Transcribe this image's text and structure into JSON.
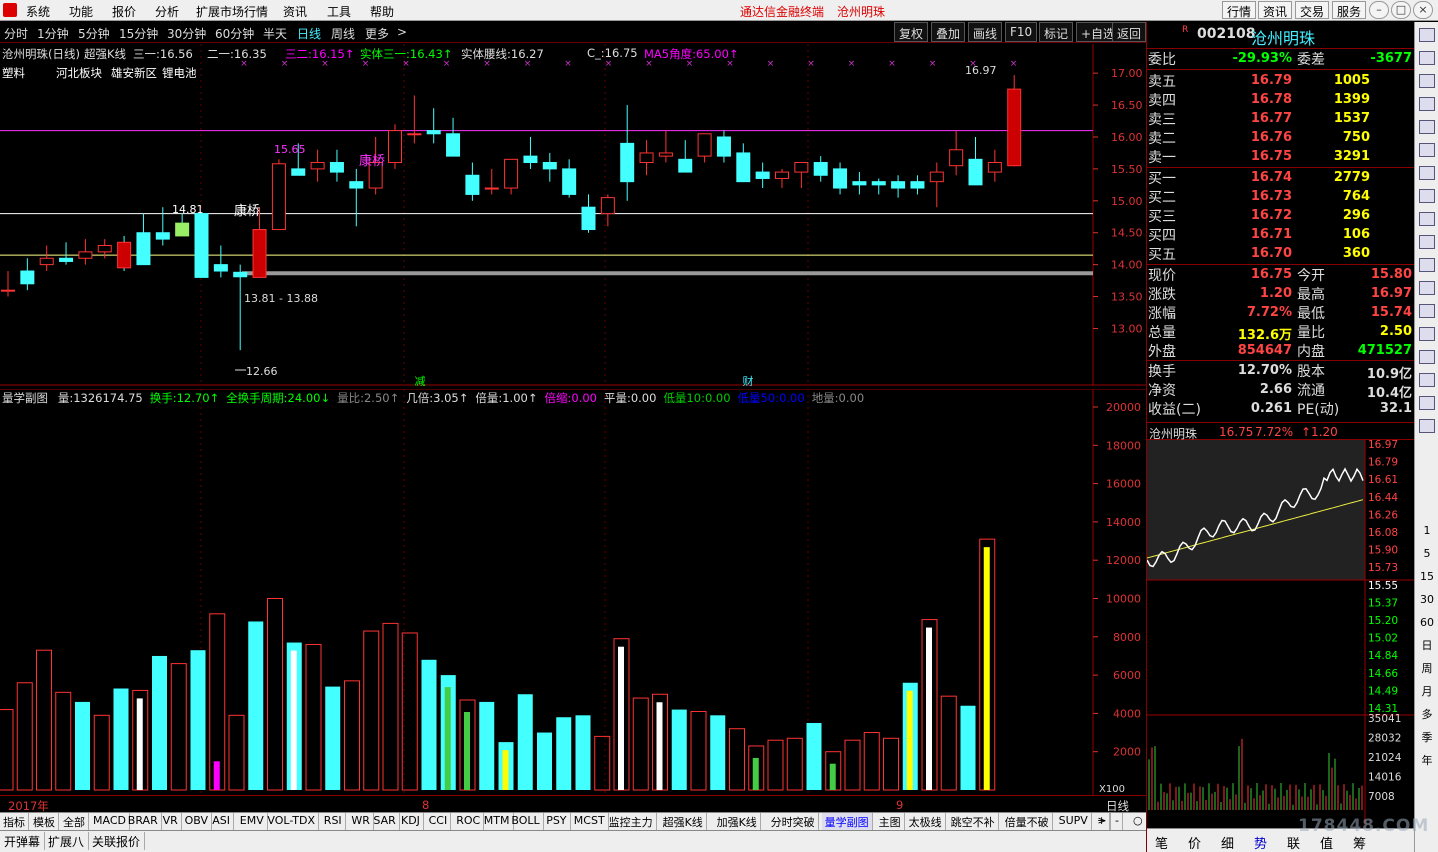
{
  "menu": {
    "items": [
      "系统",
      "功能",
      "报价",
      "分析",
      "扩展市场行情",
      "资讯",
      "工具",
      "帮助"
    ],
    "title_app": "通达信金融终端",
    "title_stock": "沧州明珠",
    "right_buttons": [
      "行情",
      "资讯",
      "交易",
      "服务"
    ]
  },
  "periods": {
    "items": [
      "分时",
      "1分钟",
      "5分钟",
      "15分钟",
      "30分钟",
      "60分钟",
      "半天",
      "日线",
      "周线",
      "更多"
    ],
    "selected": "日线",
    "tools": [
      "复权",
      "叠加",
      "画线",
      "F10",
      "标记",
      "+自选",
      "返回"
    ]
  },
  "main_title": {
    "name": "沧州明珠(日线)",
    "indicator": "超强K线",
    "l1": "三一:16.56",
    "l2": "二一:16.35",
    "l3": "三二:16.15↑",
    "l4": "实体三一:16.43↑",
    "l5": "实体腰线:16.27",
    "l6": "C_:16.75",
    "l7": "MA5角度:65.00↑"
  },
  "main_tags": {
    "industry": "塑料",
    "concepts": [
      "河北板块",
      "雄安新区",
      "锂电池"
    ]
  },
  "chart_data": {
    "type": "candlestick",
    "y_axis_ticks": [
      "17.00",
      "16.50",
      "16.00",
      "15.50",
      "15.00",
      "14.50",
      "14.00",
      "13.50",
      "13.00"
    ],
    "ylim": [
      12.6,
      17.3
    ],
    "candles": [
      [
        13.6,
        13.9,
        13.5,
        13.6
      ],
      [
        13.9,
        14.1,
        13.6,
        13.7
      ],
      [
        14.0,
        14.3,
        13.9,
        14.1
      ],
      [
        14.1,
        14.35,
        14.0,
        14.05
      ],
      [
        14.1,
        14.4,
        14.0,
        14.2
      ],
      [
        14.2,
        14.4,
        14.1,
        14.3
      ],
      [
        14.35,
        14.45,
        13.9,
        13.95
      ],
      [
        14.5,
        14.8,
        14.0,
        14.0
      ],
      [
        14.5,
        14.9,
        14.3,
        14.4
      ],
      [
        14.65,
        14.8,
        14.5,
        14.45
      ],
      [
        14.8,
        14.81,
        14.3,
        13.8
      ],
      [
        14.0,
        14.3,
        13.8,
        13.9
      ],
      [
        13.88,
        14.0,
        12.66,
        13.81
      ],
      [
        13.8,
        14.9,
        13.8,
        14.55
      ],
      [
        14.55,
        15.65,
        14.55,
        15.58
      ],
      [
        15.5,
        15.9,
        15.4,
        15.4
      ],
      [
        15.5,
        15.8,
        15.3,
        15.6
      ],
      [
        15.6,
        15.8,
        15.3,
        15.45
      ],
      [
        15.3,
        15.5,
        14.6,
        15.2
      ],
      [
        15.2,
        16.0,
        15.1,
        15.6
      ],
      [
        15.6,
        16.2,
        15.5,
        16.1
      ],
      [
        16.05,
        16.65,
        15.9,
        16.05
      ],
      [
        16.1,
        16.45,
        15.9,
        16.05
      ],
      [
        16.05,
        16.3,
        15.8,
        15.7
      ],
      [
        15.4,
        15.6,
        15.0,
        15.1
      ],
      [
        15.2,
        15.5,
        15.1,
        15.2
      ],
      [
        15.2,
        15.6,
        15.1,
        15.65
      ],
      [
        15.7,
        16.0,
        15.5,
        15.6
      ],
      [
        15.6,
        15.75,
        15.3,
        15.5
      ],
      [
        15.5,
        15.65,
        15.05,
        15.1
      ],
      [
        14.9,
        15.1,
        14.5,
        14.55
      ],
      [
        14.8,
        15.1,
        14.6,
        15.05
      ],
      [
        15.9,
        16.5,
        15.0,
        15.3
      ],
      [
        15.6,
        15.95,
        15.4,
        15.75
      ],
      [
        15.7,
        16.1,
        15.6,
        15.75
      ],
      [
        15.65,
        15.95,
        15.5,
        15.45
      ],
      [
        15.7,
        16.0,
        15.6,
        16.05
      ],
      [
        16.0,
        16.1,
        15.6,
        15.7
      ],
      [
        15.75,
        15.9,
        15.3,
        15.3
      ],
      [
        15.45,
        15.6,
        15.2,
        15.35
      ],
      [
        15.35,
        15.5,
        15.2,
        15.45
      ],
      [
        15.45,
        15.6,
        15.2,
        15.6
      ],
      [
        15.6,
        15.7,
        15.3,
        15.4
      ],
      [
        15.5,
        15.6,
        15.1,
        15.2
      ],
      [
        15.3,
        15.45,
        15.1,
        15.25
      ],
      [
        15.3,
        15.35,
        15.1,
        15.25
      ],
      [
        15.3,
        15.4,
        15.05,
        15.2
      ],
      [
        15.3,
        15.4,
        15.1,
        15.2
      ],
      [
        15.3,
        15.6,
        14.9,
        15.45
      ],
      [
        15.55,
        16.1,
        15.4,
        15.8
      ],
      [
        15.65,
        16.0,
        15.4,
        15.25
      ],
      [
        15.45,
        15.8,
        15.3,
        15.6
      ],
      [
        15.55,
        16.97,
        15.54,
        16.75
      ]
    ],
    "annotations": {
      "hi1": "14.81",
      "hi2": "15.65",
      "low_label": "12.66",
      "range_label": "13.81 - 13.88",
      "kq1": "康桥",
      "kq2": "康桥",
      "top_label": "16.97",
      "mark_jian": "减",
      "mark_cai": "财"
    },
    "hlines": [
      16.1,
      14.8,
      14.15
    ],
    "volume": {
      "title": "量学副图",
      "items": [
        {
          "t": "量:1326174.75",
          "c": "#ddd"
        },
        {
          "t": "换手:12.70↑",
          "c": "#0f0"
        },
        {
          "t": "全换手周期:24.00↓",
          "c": "#0f0"
        },
        {
          "t": "量比:2.50↑",
          "c": "#888"
        },
        {
          "t": "几倍:3.05↑",
          "c": "#ddd"
        },
        {
          "t": "倍量:1.00↑",
          "c": "#ddd"
        },
        {
          "t": "倍缩:0.00",
          "c": "#f0f"
        },
        {
          "t": "平量:0.00",
          "c": "#ddd"
        },
        {
          "t": "低量10:0.00",
          "c": "#0c0"
        },
        {
          "t": "低量50:0.00",
          "c": "#00f"
        },
        {
          "t": "地量:0.00",
          "c": "#888"
        }
      ],
      "y_axis_ticks": [
        "20000",
        "18000",
        "16000",
        "14000",
        "12000",
        "10000",
        "8000",
        "6000",
        "4000",
        "2000"
      ],
      "unit": "X100",
      "values": [
        4200,
        5600,
        7300,
        5100,
        4600,
        3900,
        5300,
        5200,
        7000,
        6600,
        7300,
        9200,
        3900,
        8800,
        10000,
        7700,
        7600,
        5400,
        5700,
        8300,
        8700,
        8200,
        6800,
        6000,
        4700,
        4600,
        2500,
        5000,
        3000,
        3800,
        3900,
        2800,
        7900,
        4800,
        5000,
        4200,
        4100,
        3900,
        3200,
        2300,
        2600,
        2700,
        3500,
        2000,
        2600,
        3000,
        2700,
        5600,
        8900,
        4900,
        4400,
        13100
      ],
      "colors": [
        "r",
        "r",
        "r",
        "r",
        "c",
        "r",
        "c",
        "r",
        "c",
        "r",
        "c",
        "r",
        "r",
        "c",
        "r",
        "c",
        "r",
        "c",
        "r",
        "r",
        "r",
        "r",
        "c",
        "c",
        "r",
        "c",
        "c",
        "c",
        "c",
        "c",
        "c",
        "r",
        "r",
        "r",
        "r",
        "c",
        "r",
        "c",
        "r",
        "r",
        "r",
        "r",
        "c",
        "r",
        "r",
        "r",
        "r",
        "c",
        "r",
        "r",
        "c",
        "r"
      ]
    },
    "time_axis": {
      "labels": [
        "2017年",
        "8",
        "9"
      ],
      "right": "日线"
    }
  },
  "bottom_tabs": [
    "指标",
    "模板",
    "全部",
    "MACD",
    "BRAR",
    "VR",
    "OBV",
    "ASI",
    "EMV",
    "VOL-TDX",
    "RSI",
    "WR",
    "SAR",
    "KDJ",
    "CCI",
    "ROC",
    "MTM",
    "BOLL",
    "PSY",
    "MCST",
    "监控主力",
    "超强K线",
    "加强K线",
    "分时突破",
    "量学副图",
    "主图",
    "太极线",
    "跳空不补",
    "倍量不破",
    "SUPV"
  ],
  "bottom_selected": "量学副图",
  "status_tabs": [
    "开弹幕",
    "扩展八",
    "关联报价"
  ],
  "quote": {
    "code": "002108",
    "name": "沧州明珠",
    "wb_label": "委比",
    "wb": "-29.93%",
    "wc_label": "委差",
    "wc": "-3677",
    "sells": [
      {
        "l": "卖五",
        "p": "16.79",
        "v": "1005"
      },
      {
        "l": "卖四",
        "p": "16.78",
        "v": "1399"
      },
      {
        "l": "卖三",
        "p": "16.77",
        "v": "1537"
      },
      {
        "l": "卖二",
        "p": "16.76",
        "v": "750"
      },
      {
        "l": "卖一",
        "p": "16.75",
        "v": "3291"
      }
    ],
    "buys": [
      {
        "l": "买一",
        "p": "16.74",
        "v": "2779"
      },
      {
        "l": "买二",
        "p": "16.73",
        "v": "764"
      },
      {
        "l": "买三",
        "p": "16.72",
        "v": "296"
      },
      {
        "l": "买四",
        "p": "16.71",
        "v": "106"
      },
      {
        "l": "买五",
        "p": "16.70",
        "v": "360"
      }
    ],
    "stats": [
      {
        "l": "现价",
        "v": "16.75",
        "l2": "今开",
        "v2": "15.80"
      },
      {
        "l": "涨跌",
        "v": "1.20",
        "l2": "最高",
        "v2": "16.97"
      },
      {
        "l": "涨幅",
        "v": "7.72%",
        "l2": "最低",
        "v2": "15.74"
      },
      {
        "l": "总量",
        "v": "132.6万",
        "l2": "量比",
        "v2": "2.50"
      },
      {
        "l": "外盘",
        "v": "854647",
        "l2": "内盘",
        "v2": "471527"
      }
    ],
    "fund": [
      {
        "l": "换手",
        "v": "12.70%",
        "l2": "股本",
        "v2": "10.9亿"
      },
      {
        "l": "净资",
        "v": "2.66",
        "l2": "流通",
        "v2": "10.4亿"
      },
      {
        "l": "收益(二)",
        "v": "0.261",
        "l2": "PE(动)",
        "v2": "32.1"
      }
    ]
  },
  "mini": {
    "name": "沧州明珠",
    "price": "16.75",
    "pct": "7.72%",
    "chg": "↑1.20",
    "price_ticks": [
      "16.97",
      "16.79",
      "16.61",
      "16.44",
      "16.26",
      "16.08",
      "15.90",
      "15.73",
      "15.55",
      "15.37",
      "15.20",
      "15.02",
      "14.84",
      "14.66",
      "14.49",
      "14.31"
    ],
    "vol_ticks": [
      "35041",
      "28032",
      "21024",
      "14016",
      "7008"
    ]
  },
  "mini_tabs": [
    "笔",
    "价",
    "细",
    "势",
    "联",
    "值",
    "筹"
  ],
  "right_toolbar": [
    "1",
    "5",
    "15",
    "30",
    "60",
    "日",
    "周",
    "月",
    "多",
    "季",
    "年"
  ],
  "watermark": "178448.COM"
}
